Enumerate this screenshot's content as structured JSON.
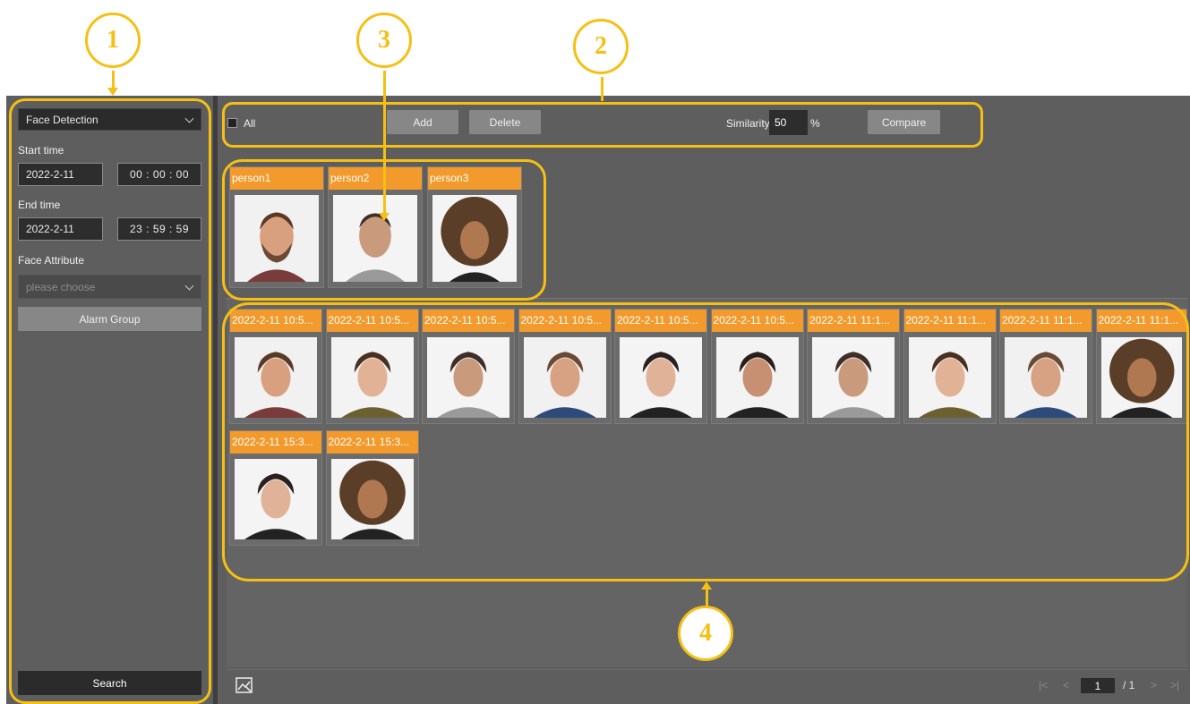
{
  "sidebar": {
    "mode_select": "Face Detection",
    "start_time_label": "Start time",
    "start_date": "2022-2-11",
    "start_time": "00 : 00 : 00",
    "end_time_label": "End time",
    "end_date": "2022-2-11",
    "end_time": "23 : 59 : 59",
    "face_attribute_label": "Face Attribute",
    "face_attribute_placeholder": "please choose",
    "alarm_group_button": "Alarm Group",
    "search_button": "Search"
  },
  "toolbar": {
    "all_label": "All",
    "add_button": "Add",
    "delete_button": "Delete",
    "similarity_label": "Similarity",
    "similarity_value": "50",
    "similarity_unit": "%",
    "compare_button": "Compare"
  },
  "persons": [
    {
      "name": "person1"
    },
    {
      "name": "person2"
    },
    {
      "name": "person3"
    }
  ],
  "results": [
    {
      "time": "2022-2-11 10:5..."
    },
    {
      "time": "2022-2-11 10:5..."
    },
    {
      "time": "2022-2-11 10:5..."
    },
    {
      "time": "2022-2-11 10:5..."
    },
    {
      "time": "2022-2-11 10:5..."
    },
    {
      "time": "2022-2-11 10:5..."
    },
    {
      "time": "2022-2-11 11:1..."
    },
    {
      "time": "2022-2-11 11:1..."
    },
    {
      "time": "2022-2-11 11:1..."
    },
    {
      "time": "2022-2-11 11:1..."
    },
    {
      "time": "2022-2-11 15:3..."
    },
    {
      "time": "2022-2-11 15:3..."
    }
  ],
  "pager": {
    "current_page": "1",
    "total_pages": "/ 1"
  },
  "callouts": [
    "1",
    "2",
    "3",
    "4"
  ],
  "colors": {
    "accent_orange": "#f39a2c",
    "callout_yellow": "#f5c013",
    "panel_grey": "#5e5e5e"
  }
}
